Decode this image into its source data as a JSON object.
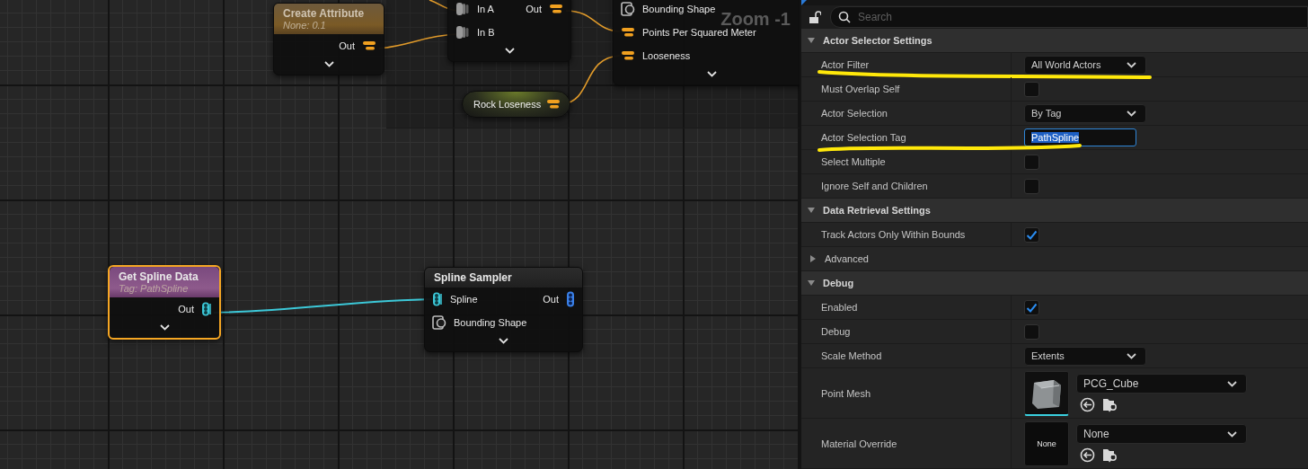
{
  "graph": {
    "zoom_label": "Zoom -1",
    "nodes": [
      {
        "kind": "attribute",
        "title": "Create Attribute",
        "subtitle": "None: 0.1",
        "selected": false,
        "outputs": [
          {
            "label": "Out",
            "kind": "attribute"
          }
        ]
      },
      {
        "kind": "headless",
        "selected": false,
        "inputs": [
          {
            "label": "In A",
            "kind": "any"
          },
          {
            "label": "In B",
            "kind": "any"
          }
        ],
        "outputs": [
          {
            "label": "Out",
            "kind": "attribute"
          }
        ]
      },
      {
        "kind": "headless",
        "selected": false,
        "inputs": [
          {
            "label": "Bounding Shape",
            "kind": "shape"
          },
          {
            "label": "Points Per Squared Meter",
            "kind": "attribute"
          },
          {
            "label": "Looseness",
            "kind": "attribute"
          }
        ]
      },
      {
        "kind": "variable",
        "title": "Rock Loseness",
        "selected": false,
        "outputs": [
          {
            "kind": "attribute"
          }
        ]
      },
      {
        "kind": "source",
        "title": "Get Spline Data",
        "subtitle": "Tag: PathSpline",
        "selected": true,
        "outputs": [
          {
            "label": "Out",
            "kind": "spatial"
          }
        ]
      },
      {
        "kind": "plain",
        "title": "Spline Sampler",
        "selected": false,
        "inputs": [
          {
            "label": "Spline",
            "kind": "spatial"
          },
          {
            "label": "Bounding Shape",
            "kind": "shape"
          }
        ],
        "outputs": [
          {
            "label": "Out",
            "kind": "point"
          }
        ]
      }
    ]
  },
  "details": {
    "search": {
      "placeholder": "Search"
    },
    "rows": [
      {
        "kind": "section",
        "label": "Actor Selector Settings",
        "expanded": true
      },
      {
        "kind": "dropdown",
        "label": "Actor Filter",
        "value": "All World Actors",
        "underlined": true
      },
      {
        "kind": "checkbox",
        "label": "Must Overlap Self",
        "checked": false,
        "underlined": false
      },
      {
        "kind": "dropdown",
        "label": "Actor Selection",
        "value": "By Tag",
        "underlined": false
      },
      {
        "kind": "text",
        "label": "Actor Selection Tag",
        "value": "PathSpline",
        "text_selected": true,
        "underlined": true
      },
      {
        "kind": "checkbox",
        "label": "Select Multiple",
        "checked": false,
        "underlined": false
      },
      {
        "kind": "checkbox",
        "label": "Ignore Self and Children",
        "checked": false,
        "underlined": false
      },
      {
        "kind": "section",
        "label": "Data Retrieval Settings",
        "expanded": true
      },
      {
        "kind": "checkbox",
        "label": "Track Actors Only Within Bounds",
        "checked": true,
        "underlined": false
      },
      {
        "kind": "subsection",
        "label": "Advanced",
        "expanded": false
      },
      {
        "kind": "section",
        "label": "Debug",
        "expanded": true
      },
      {
        "kind": "checkbox",
        "label": "Enabled",
        "checked": true,
        "underlined": false
      },
      {
        "kind": "checkbox",
        "label": "Debug",
        "checked": false,
        "underlined": false
      },
      {
        "kind": "dropdown",
        "label": "Scale Method",
        "value": "Extents",
        "underlined": false
      },
      {
        "kind": "asset",
        "label": "Point Mesh",
        "value": "PCG_Cube",
        "underlined": false
      },
      {
        "kind": "asset",
        "label": "Material Override",
        "value": "None",
        "thumbnail": {
          "kind": "text",
          "text": "None"
        },
        "underlined": false
      }
    ]
  }
}
